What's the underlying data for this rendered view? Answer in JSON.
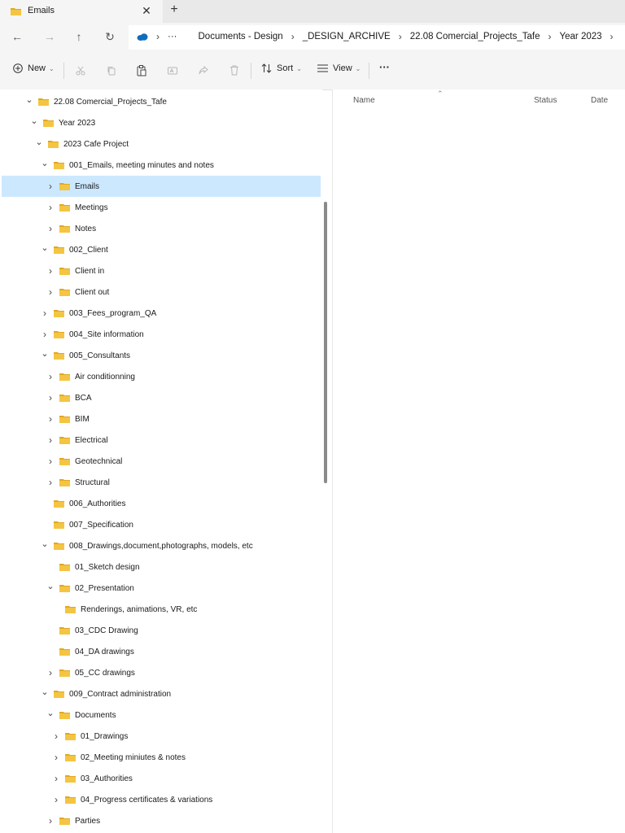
{
  "tab": {
    "title": "Emails",
    "close": "✕",
    "new": "+"
  },
  "nav": {
    "back": "←",
    "forward": "→",
    "up": "↑",
    "refresh": "↻"
  },
  "breadcrumb": {
    "overflow": "···",
    "items": [
      "Documents - Design",
      "_DESIGN_ARCHIVE",
      "22.08 Comercial_Projects_Tafe",
      "Year 2023"
    ]
  },
  "toolbar": {
    "new_label": "New",
    "sort_label": "Sort",
    "view_label": "View",
    "more_label": "···"
  },
  "tree": [
    {
      "label": "22.08 Comercial_Projects_Tafe",
      "level": 0,
      "state": "expanded"
    },
    {
      "label": "Year 2023",
      "level": 1,
      "state": "expanded"
    },
    {
      "label": "2023 Cafe Project",
      "level": 2,
      "state": "expanded"
    },
    {
      "label": "001_Emails, meeting minutes and notes",
      "level": 3,
      "state": "expanded"
    },
    {
      "label": "Emails",
      "level": 4,
      "state": "collapsed",
      "selected": true
    },
    {
      "label": "Meetings",
      "level": 4,
      "state": "collapsed"
    },
    {
      "label": "Notes",
      "level": 4,
      "state": "collapsed"
    },
    {
      "label": "002_Client",
      "level": 3,
      "state": "expanded"
    },
    {
      "label": "Client in",
      "level": 4,
      "state": "collapsed"
    },
    {
      "label": "Client out",
      "level": 4,
      "state": "collapsed"
    },
    {
      "label": "003_Fees_program_QA",
      "level": 3,
      "state": "collapsed"
    },
    {
      "label": "004_Site information",
      "level": 3,
      "state": "collapsed"
    },
    {
      "label": "005_Consultants",
      "level": 3,
      "state": "expanded"
    },
    {
      "label": "Air conditionning",
      "level": 4,
      "state": "collapsed"
    },
    {
      "label": "BCA",
      "level": 4,
      "state": "collapsed"
    },
    {
      "label": "BIM",
      "level": 4,
      "state": "collapsed"
    },
    {
      "label": "Electrical",
      "level": 4,
      "state": "collapsed"
    },
    {
      "label": "Geotechnical",
      "level": 4,
      "state": "collapsed"
    },
    {
      "label": "Structural",
      "level": 4,
      "state": "collapsed"
    },
    {
      "label": "006_Authorities",
      "level": 3,
      "state": "none"
    },
    {
      "label": "007_Specification",
      "level": 3,
      "state": "none"
    },
    {
      "label": "008_Drawings,document,photographs, models, etc",
      "level": 3,
      "state": "expanded"
    },
    {
      "label": "01_Sketch design",
      "level": 4,
      "state": "none"
    },
    {
      "label": "02_Presentation",
      "level": 4,
      "state": "expanded"
    },
    {
      "label": "Renderings, animations, VR, etc",
      "level": 5,
      "state": "none"
    },
    {
      "label": "03_CDC Drawing",
      "level": 4,
      "state": "none"
    },
    {
      "label": "04_DA drawings",
      "level": 4,
      "state": "none"
    },
    {
      "label": "05_CC drawings",
      "level": 4,
      "state": "collapsed"
    },
    {
      "label": "009_Contract administration",
      "level": 3,
      "state": "expanded"
    },
    {
      "label": "Documents",
      "level": 4,
      "state": "expanded"
    },
    {
      "label": "01_Drawings",
      "level": 5,
      "state": "collapsed"
    },
    {
      "label": "02_Meeting miniutes & notes",
      "level": 5,
      "state": "collapsed"
    },
    {
      "label": "03_Authorities",
      "level": 5,
      "state": "collapsed"
    },
    {
      "label": "04_Progress certificates & variations",
      "level": 5,
      "state": "collapsed"
    },
    {
      "label": "Parties",
      "level": 4,
      "state": "collapsed"
    }
  ],
  "details": {
    "columns": [
      "Name",
      "Status",
      "Date"
    ]
  },
  "colors": {
    "folder": "#f4c542",
    "folder_dark": "#e0a820",
    "selection": "#cce8ff",
    "onedrive": "#0f6cbd"
  }
}
